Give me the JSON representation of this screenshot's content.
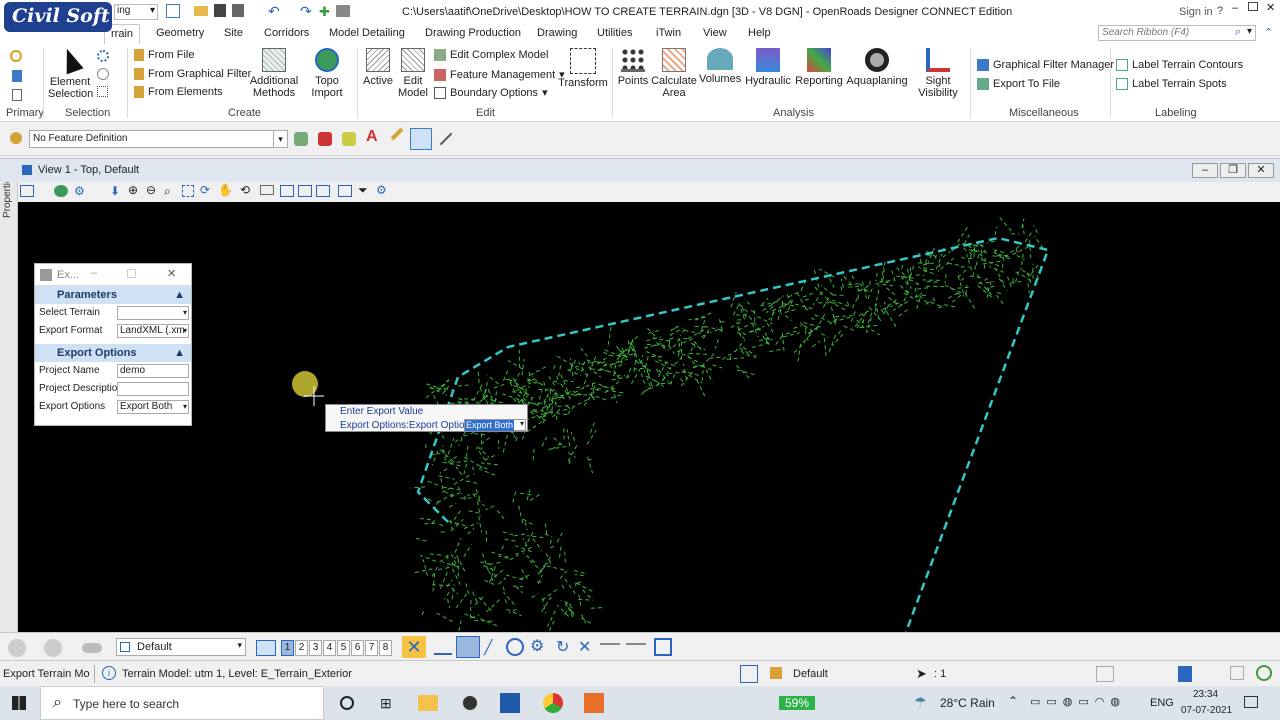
{
  "app": {
    "logo_text": "Civil Soft",
    "workflow_partial": "ing",
    "title": "C:\\Users\\aatif\\OneDrive\\Desktop\\HOW TO CREATE TERRAIN.dgn [3D - V8 DGN] - OpenRoads Designer CONNECT Edition",
    "signin": "Sign in",
    "help": "?",
    "search_placeholder": "Search Ribbon (F4)"
  },
  "tabs": [
    "rrain",
    "Geometry",
    "Site",
    "Corridors",
    "Model Detailing",
    "Drawing Production",
    "Drawing",
    "Utilities",
    "iTwin",
    "View",
    "Help"
  ],
  "ribbon": {
    "primary_label": "Primary",
    "selection": {
      "element_selection": "Element Selection",
      "label": "Selection"
    },
    "create": {
      "from_file": "From File",
      "from_graphical_filter": "From Graphical Filter",
      "from_elements": "From Elements",
      "additional_methods": "Additional Methods",
      "topo_import": "Topo Import",
      "label": "Create"
    },
    "edit": {
      "active": "Active",
      "edit_model": "Edit Model",
      "edit_complex_model": "Edit Complex Model",
      "feature_management": "Feature Management",
      "boundary_options": "Boundary Options",
      "transform": "Transform",
      "label": "Edit"
    },
    "analysis": {
      "points": "Points",
      "calculate_area": "Calculate Area",
      "volumes": "Volumes",
      "hydraulic": "Hydraulic",
      "reporting": "Reporting",
      "aquaplaning": "Aquaplaning",
      "sight_visibility": "Sight Visibility",
      "label": "Analysis"
    },
    "misc": {
      "graphical_filter_manager": "Graphical Filter Manager",
      "export_to_file": "Export To File",
      "label": "Miscellaneous"
    },
    "labeling": {
      "label_terrain_contours": "Label Terrain Contours",
      "label_terrain_spots": "Label Terrain Spots",
      "label": "Labeling"
    }
  },
  "feature_def": "No Feature Definition",
  "view": {
    "title": "View 1 - Top, Default",
    "properties_tab": "Properties"
  },
  "dialog": {
    "title": "Ex...",
    "params_header": "Parameters",
    "select_terrain_label": "Select Terrain",
    "select_terrain_value": "",
    "export_format_label": "Export Format",
    "export_format_value": "LandXML (.xm",
    "export_options_header": "Export Options",
    "project_name_label": "Project Name",
    "project_name_value": "demo",
    "project_desc_label": "Project Description",
    "project_desc_value": "",
    "export_options_label": "Export Options",
    "export_options_value": "Export Both"
  },
  "context_prompt": {
    "line1": "Enter Export Value",
    "line2": "Export Options:Export Options",
    "value": "Export Both"
  },
  "bottom": {
    "model": "Default",
    "views": [
      "1",
      "2",
      "3",
      "4",
      "5",
      "6",
      "7",
      "8"
    ]
  },
  "status": {
    "tool": "Export Terrain Mo",
    "message": "Terrain Model: utm 1, Level: E_Terrain_Exterior",
    "level": "Default",
    "count": ": 1"
  },
  "taskbar": {
    "search_placeholder": "Type here to search",
    "battery": "59%",
    "weather": "28°C  Rain",
    "lang": "ENG",
    "time": "23:34",
    "date": "07-07-2021"
  },
  "colors": {
    "boundary": "#33c7c7",
    "terrain": "#3cb43c",
    "ribbon_accent": "#1e5aa8",
    "dialog_header": "#cfe1f5"
  }
}
